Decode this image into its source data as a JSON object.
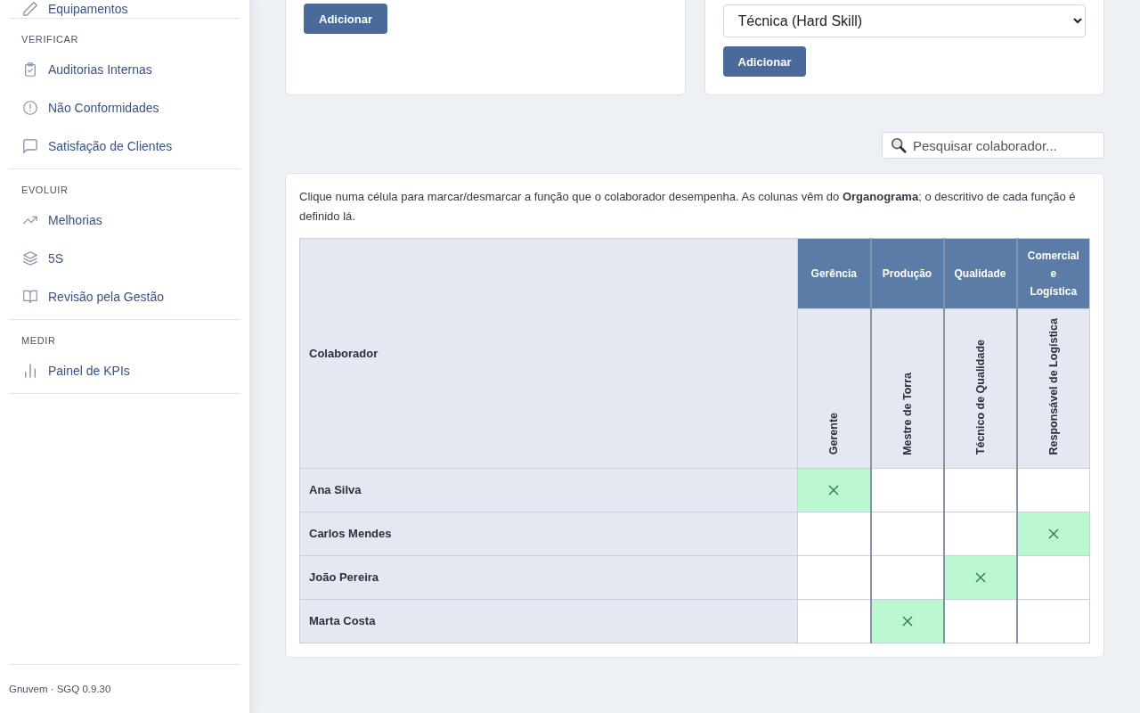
{
  "sidebar": {
    "sections": [
      {
        "items": [
          {
            "label": "Equipamentos"
          }
        ]
      },
      {
        "title": "VERIFICAR",
        "items": [
          {
            "label": "Auditorias Internas"
          },
          {
            "label": "Não Conformidades"
          },
          {
            "label": "Satisfação de Clientes"
          }
        ]
      },
      {
        "title": "EVOLUIR",
        "items": [
          {
            "label": "Melhorias"
          },
          {
            "label": "5S"
          },
          {
            "label": "Revisão pela Gestão"
          }
        ]
      },
      {
        "title": "MEDIR",
        "items": [
          {
            "label": "Painel de KPIs"
          }
        ]
      }
    ],
    "footer": "Gnuvem · SGQ 0.9.30"
  },
  "forms": [
    {
      "button": "Adicionar"
    },
    {
      "select": "Técnica (Hard Skill)",
      "button": "Adicionar"
    }
  ],
  "search": {
    "placeholder": "Pesquisar colaborador..."
  },
  "matrix": {
    "intro": "Clique numa célula para marcar/desmarcar a função que o colaborador desempenha. As colunas vêm do **Organograma**; o descritivo de cada função é definido lá.",
    "name_header": "Colaborador",
    "departments": [
      {
        "name": "Gerência",
        "roles": [
          "Gerente"
        ]
      },
      {
        "name": "Produção",
        "roles": [
          "Mestre de Torra"
        ]
      },
      {
        "name": "Qualidade",
        "roles": [
          "Técnico de Qualidade"
        ]
      },
      {
        "name": "Comercial e Logística",
        "roles": [
          "Responsável de Logística"
        ]
      }
    ],
    "rows": [
      {
        "name": "Ana Silva",
        "cells": [
          {
            "checked": true
          },
          {
            "checked": false
          },
          {
            "checked": false
          },
          {
            "checked": false
          }
        ]
      },
      {
        "name": "Carlos Mendes",
        "cells": [
          {
            "checked": false
          },
          {
            "checked": false
          },
          {
            "checked": false
          },
          {
            "checked": true
          }
        ]
      },
      {
        "name": "João Pereira",
        "cells": [
          {
            "checked": false
          },
          {
            "checked": false
          },
          {
            "checked": true
          },
          {
            "checked": false
          }
        ]
      },
      {
        "name": "Marta Costa",
        "cells": [
          {
            "checked": false
          },
          {
            "checked": true
          },
          {
            "checked": false
          },
          {
            "checked": false
          }
        ]
      }
    ]
  }
}
